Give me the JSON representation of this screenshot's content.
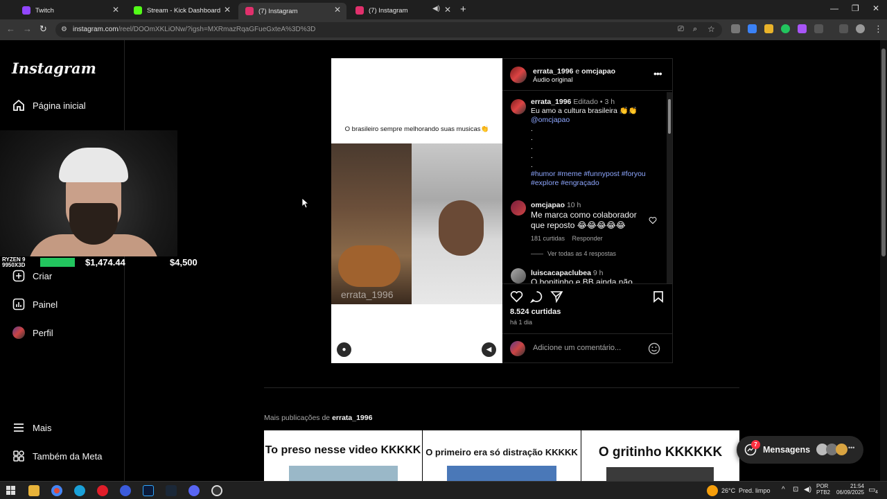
{
  "browser": {
    "tabs": [
      {
        "label": "Twitch",
        "color": "#9146ff"
      },
      {
        "label": "Stream - Kick Dashboard",
        "color": "#53fc18"
      },
      {
        "label": "(7) Instagram",
        "color": "#e1306c"
      },
      {
        "label": "(7) Instagram",
        "color": "#e1306c"
      }
    ],
    "url_host": "instagram.com",
    "url_path": "/reel/DOOmXKLiONw/?igsh=MXRmazRqaGFueGxteA%3D%3D"
  },
  "sidebar": {
    "logo": "Instagram",
    "home_label": "Página inicial",
    "create_label": "Criar",
    "dashboard_label": "Painel",
    "profile_label": "Perfil",
    "more_label": "Mais",
    "meta_label": "Também da Meta"
  },
  "overlay": {
    "cpu_label": "RYZEN 9 9950X3D",
    "value_left": "$1,474.44",
    "value_right": "$4,500"
  },
  "post": {
    "media_caption": "O brasileiro sempre melhorando suas musicas👏",
    "watermark": "errata_1996",
    "author": "errata_1996",
    "connector": "e",
    "coauthor": "omcjapao",
    "audio": "Áudio original",
    "caption_user": "errata_1996",
    "caption_edited": "Editado",
    "caption_time": "3 h",
    "caption_text": "Eu amo a cultura brasileira 👏👏",
    "caption_mention": "@omcjapao",
    "caption_tags_1": "#humor #meme #funnypost #foryou",
    "caption_tags_2": "#explore #engraçado",
    "comment1_user": "omcjapao",
    "comment1_time": "10 h",
    "comment1_text_1": "Me marca como colaborador",
    "comment1_text_2": "que reposto 😂😂😂😂😂",
    "comment1_likes": "181 curtidas",
    "comment1_reply": "Responder",
    "view_replies": "Ver todas as 4 respostas",
    "comment2_user": "luiscacapaclubea",
    "comment2_time": "9 h",
    "comment2_text": "O bonitinho e BB ainda não",
    "likes": "8.524 curtidas",
    "posted_ago": "há 1 dia",
    "add_comment_placeholder": "Adicione um comentário..."
  },
  "more": {
    "heading_prefix": "Mais publicações de",
    "heading_user": "errata_1996",
    "thumbs": [
      {
        "title": "To preso nesse video KKKKK"
      },
      {
        "title": "O primeiro era só distração KKKKK"
      },
      {
        "title": "O gritinho KKKKKK"
      }
    ]
  },
  "messages": {
    "label": "Mensagens",
    "badge": "7"
  },
  "taskbar": {
    "temperature": "26°C",
    "weather": "Pred. limpo",
    "lang_1": "POR",
    "lang_2": "PTB2",
    "time": "21:54",
    "date": "06/09/2025",
    "notif_count": "4"
  }
}
